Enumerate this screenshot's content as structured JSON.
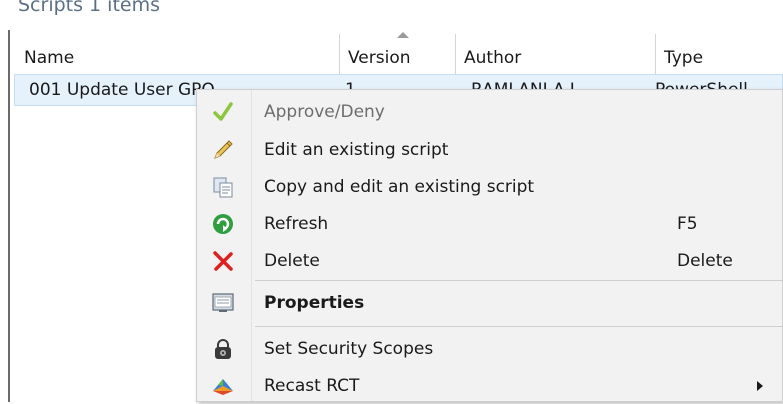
{
  "panel": {
    "title": "Scripts 1 items"
  },
  "columns": {
    "name": "Name",
    "version": "Version",
    "author": "Author",
    "type": "Type"
  },
  "rows": [
    {
      "name": "001 Update User GPO",
      "version": "1",
      "author": "RAMLANI A.L",
      "type": "PowerShell"
    }
  ],
  "context_menu": {
    "items": [
      {
        "label": "Approve/Deny",
        "icon": "checkmark-icon",
        "disabled": true,
        "shortcut": ""
      },
      {
        "label": "Edit an existing script",
        "icon": "pencil-icon",
        "disabled": false,
        "shortcut": ""
      },
      {
        "label": "Copy and edit an existing script",
        "icon": "copy-icon",
        "disabled": false,
        "shortcut": ""
      },
      {
        "label": "Refresh",
        "icon": "refresh-icon",
        "disabled": false,
        "shortcut": "F5"
      },
      {
        "label": "Delete",
        "icon": "delete-icon",
        "disabled": false,
        "shortcut": "Delete"
      },
      {
        "label": "Properties",
        "icon": "properties-icon",
        "disabled": false,
        "shortcut": "",
        "bold": true
      },
      {
        "label": "Set Security Scopes",
        "icon": "lock-icon",
        "disabled": false,
        "shortcut": ""
      },
      {
        "label": "Recast RCT",
        "icon": "recast-icon",
        "disabled": false,
        "shortcut": "",
        "submenu": true
      }
    ]
  },
  "colors": {
    "selection": "#e5f1fb",
    "menu_bg": "#f2f2f2",
    "title": "#5a6f87",
    "check_green": "#8cc63f",
    "refresh_green": "#2e9e3e",
    "delete_red": "#e02020"
  }
}
